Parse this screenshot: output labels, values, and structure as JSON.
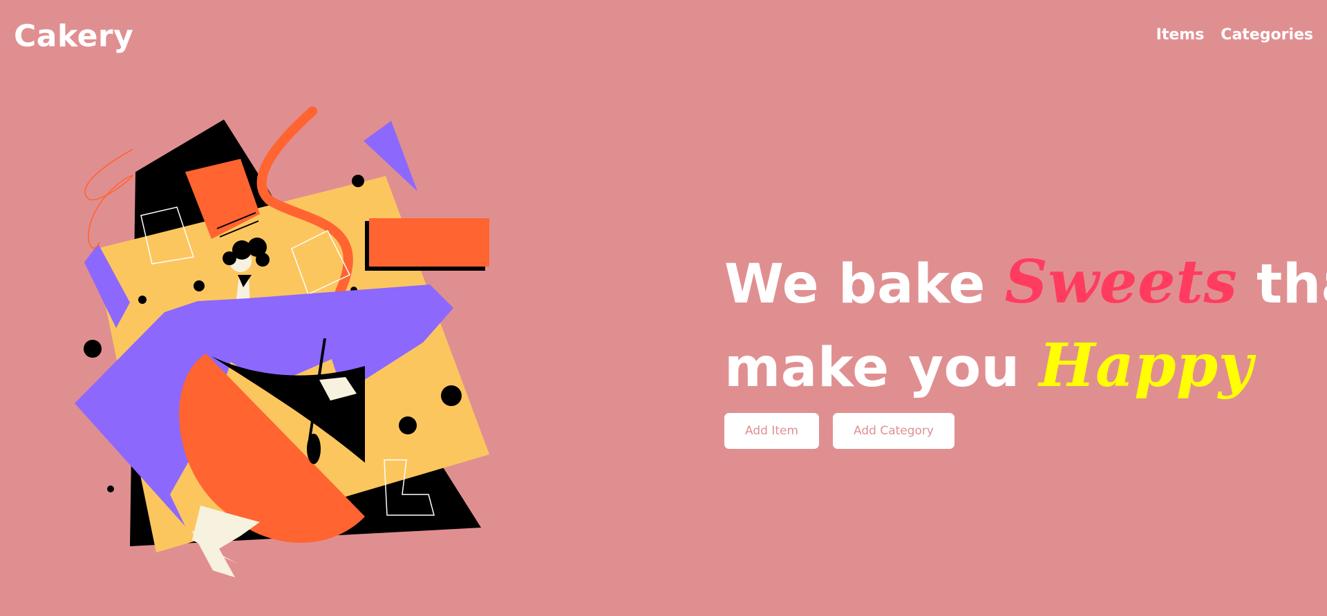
{
  "brand": {
    "logo_text": "Cakery"
  },
  "nav": {
    "items": [
      {
        "label": "Items"
      },
      {
        "label": "Categories"
      }
    ]
  },
  "hero": {
    "headline": {
      "line1_part1": "We bake ",
      "line1_script": "Sweets",
      "line1_part2": " that",
      "line2_part1": "make you ",
      "line2_script": "Happy"
    },
    "buttons": {
      "add_item": "Add Item",
      "add_category": "Add Category"
    },
    "illustration": {
      "icon": "baker-mixing-bowl-illustration"
    }
  },
  "colors": {
    "background": "#e08f91",
    "text": "#ffffff",
    "accent_sweets": "#ff3c5f",
    "accent_happy": "#ffff00",
    "button_bg": "#ffffff",
    "button_text": "#e08f91"
  }
}
